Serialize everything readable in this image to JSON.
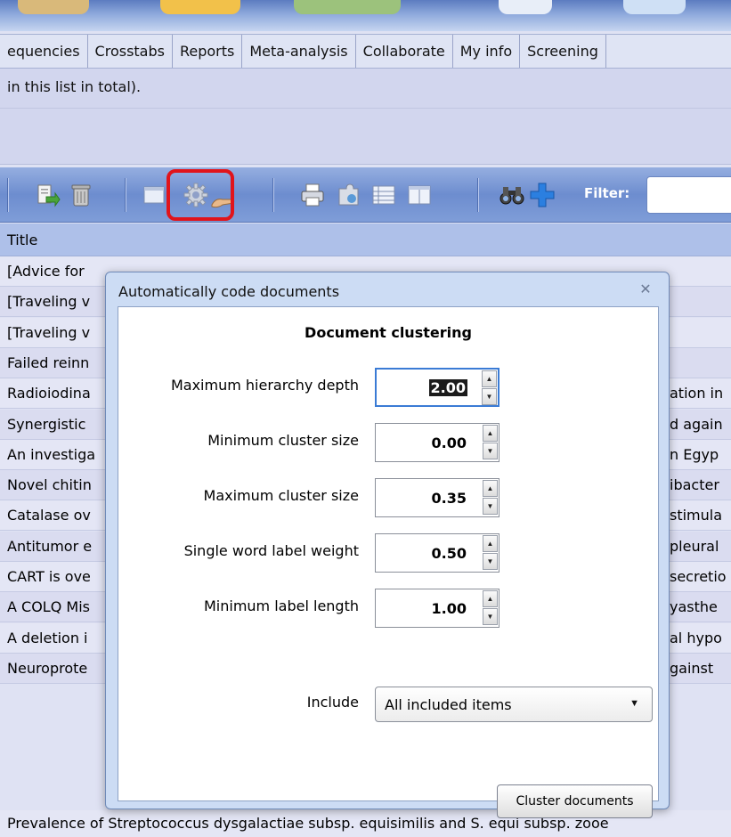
{
  "tabs": [
    "equencies",
    "Crosstabs",
    "Reports",
    "Meta-analysis",
    "Collaborate",
    "My info",
    "Screening"
  ],
  "info_text": "in this list in total).",
  "toolbar": {
    "filter_label": "Filter:"
  },
  "grid": {
    "header": "Title",
    "rows": [
      {
        "left": "[Advice for",
        "right": ""
      },
      {
        "left": "[Traveling v",
        "right": ""
      },
      {
        "left": "[Traveling v",
        "right": ""
      },
      {
        "left": "Failed reinn",
        "right": ""
      },
      {
        "left": "Radioiodina",
        "right": "ation in"
      },
      {
        "left": "Synergistic",
        "right": "d again"
      },
      {
        "left": "An investiga",
        "right": "n Egyp"
      },
      {
        "left": "Novel chitin",
        "right": "ibacter"
      },
      {
        "left": "Catalase ov",
        "right": "stimula"
      },
      {
        "left": "Antitumor e",
        "right": "pleural"
      },
      {
        "left": "CART is ove",
        "right": "secretio"
      },
      {
        "left": "A COLQ Mis",
        "right": "yasthe"
      },
      {
        "left": "A deletion i",
        "right": "al hypo"
      },
      {
        "left": "Neuroprote",
        "right": "gainst"
      }
    ],
    "last_row": "Prevalence of Streptococcus dysgalactiae subsp. equisimilis and S. equi subsp. zooe"
  },
  "dialog": {
    "title": "Automatically code documents",
    "heading": "Document clustering",
    "fields": [
      {
        "label": "Maximum hierarchy depth",
        "value": "2.00"
      },
      {
        "label": "Minimum cluster size",
        "value": "0.00"
      },
      {
        "label": "Maximum cluster size",
        "value": "0.35"
      },
      {
        "label": "Single word label weight",
        "value": "0.50"
      },
      {
        "label": "Minimum label length",
        "value": "1.00"
      }
    ],
    "include_label": "Include",
    "include_value": "All included items",
    "cluster_button": "Cluster documents"
  }
}
